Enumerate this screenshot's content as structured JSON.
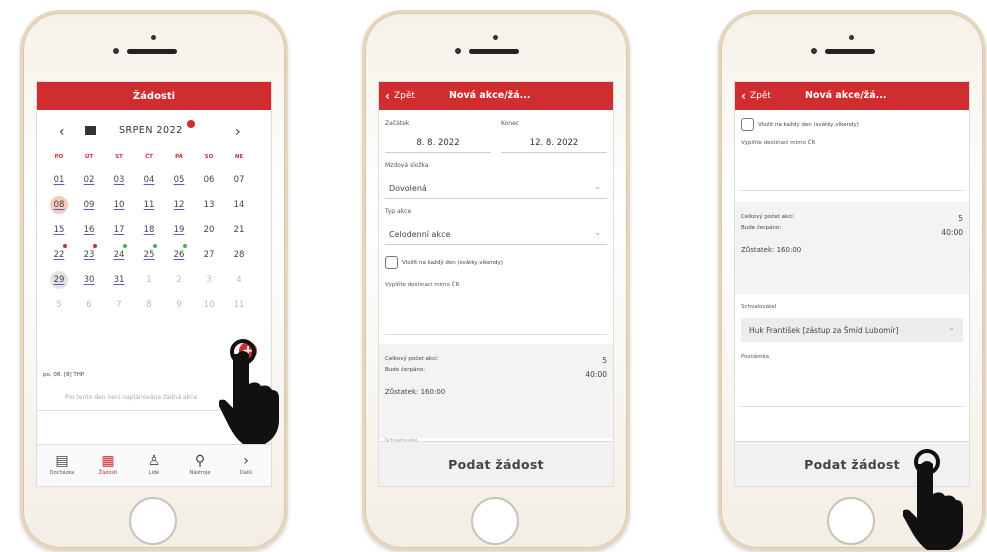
{
  "phone1": {
    "header_title": "Žádosti",
    "month_label": "SRPEN 2022",
    "badge_count": "",
    "weekdays": [
      "PO",
      "ÚT",
      "ST",
      "ČT",
      "PÁ",
      "SO",
      "NE"
    ],
    "rows": [
      [
        "01",
        "02",
        "03",
        "04",
        "05",
        "06",
        "07"
      ],
      [
        "08",
        "09",
        "10",
        "11",
        "12",
        "13",
        "14"
      ],
      [
        "15",
        "16",
        "17",
        "18",
        "19",
        "20",
        "21"
      ],
      [
        "22",
        "23",
        "24",
        "25",
        "26",
        "27",
        "28"
      ],
      [
        "29",
        "30",
        "31",
        "1",
        "2",
        "3",
        "4"
      ],
      [
        "5",
        "6",
        "7",
        "8",
        "9",
        "10",
        "11"
      ]
    ],
    "day_info": "po, 08. [8] THP",
    "empty_text": "Pro tento den není naplánována žádná akce",
    "tabs": [
      "Docházka",
      "Žádosti",
      "Lidé",
      "Nástroje",
      "Další"
    ],
    "tab_icons": [
      "clipboard-icon",
      "calendar-icon",
      "people-icon",
      "tools-icon",
      "chevron-right-icon"
    ],
    "accent": "#cf2d2f"
  },
  "phone2": {
    "back_label": "Zpět",
    "header_title": "Nová akce/žá...",
    "start_label": "Začátek",
    "end_label": "Konec",
    "start_value": "8. 8. 2022",
    "end_value": "12. 8. 2022",
    "reason_label": "Mzdová složka",
    "reason_value": "Dovolená",
    "type_label": "Typ akce",
    "type_value": "Celodenní akce",
    "checkbox_label": "Vložit na každý den (svátky,víkendy)",
    "dest_label": "Vyplňte destinaci mimo ČR",
    "total_label": "Celkový počet akcí:",
    "total_value": "5",
    "will_use_label": "Bude čerpáno:",
    "will_use_value": "40:00",
    "remain_label": "Zůstatek: 160:00",
    "approver_peek": "Schvalovatel",
    "submit_label": "Podat žádost"
  },
  "phone3": {
    "back_label": "Zpět",
    "header_title": "Nová akce/žá...",
    "checkbox_label": "Vložit na každý den (svátky,víkendy)",
    "dest_label": "Vyplňte destinaci mimo ČR",
    "total_label": "Celkový počet akcí:",
    "total_value": "5",
    "will_use_label": "Bude čerpáno:",
    "will_use_value": "40:00",
    "remain_label": "Zůstatek: 160:00",
    "approver_label": "Schvalovatel",
    "approver_value": "Huk František [zástup za Šmíd Lubomír]",
    "note_label": "Poznámka",
    "submit_label": "Podat žádost"
  }
}
